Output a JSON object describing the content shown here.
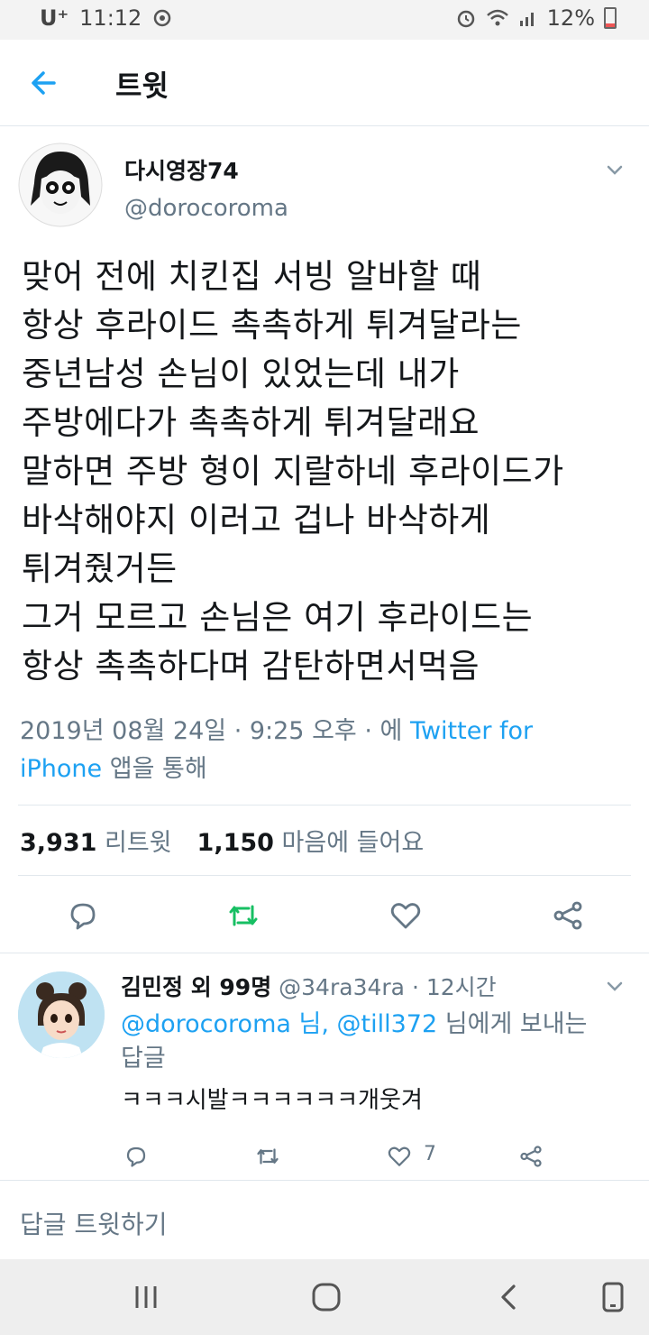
{
  "status_bar": {
    "carrier": "U⁺",
    "time": "11:12",
    "battery": "12%"
  },
  "header": {
    "title": "트윗"
  },
  "tweet": {
    "display_name": "다시영장74",
    "handle": "@dorocoroma",
    "text": "맞어 전에 치킨집 서빙 알바할 때\n항상 후라이드 촉촉하게 튀겨달라는\n중년남성 손님이 있었는데 내가\n주방에다가 촉촉하게 튀겨달래요\n말하면 주방 형이 지랄하네 후라이드가\n바삭해야지 이러고 겁나 바삭하게\n튀겨줬거든\n그거 모르고 손님은 여기 후라이드는\n항상 촉촉하다며 감탄하면서먹음",
    "timestamp": "2019년 08월 24일 · 9:25 오후 · 에",
    "source_link": "Twitter for iPhone",
    "source_suffix": "앱을 통해",
    "retweet_count": "3,931",
    "retweet_label": "리트윗",
    "like_count": "1,150",
    "like_label": "마음에 들어요"
  },
  "reply": {
    "name": "김민정 외 99명",
    "handle": "@34ra34ra",
    "time": "· 12시간",
    "mention1": "@dorocoroma 님,",
    "mention2": "@till372",
    "reply_to_suffix": "님에게 보내는 답글",
    "text": "ㅋㅋㅋ시발ㅋㅋㅋㅋㅋㅋ개웃겨",
    "likes": "7"
  },
  "compose": {
    "placeholder": "답글 트윗하기"
  },
  "colors": {
    "accent": "#1da1f2",
    "retweet_green": "#17bf63",
    "secondary_text": "#657786"
  }
}
